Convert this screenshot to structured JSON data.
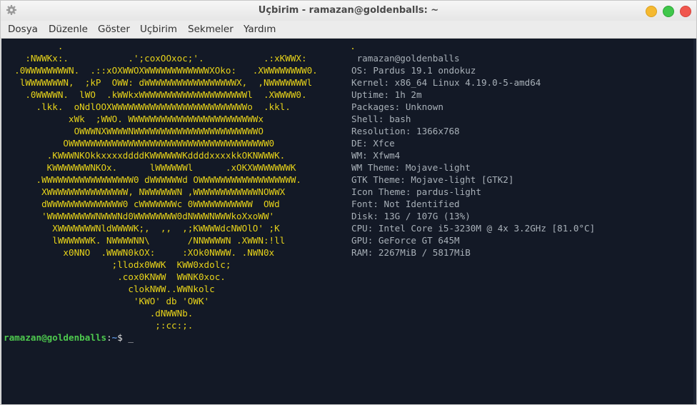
{
  "window": {
    "title": "Uçbirim - ramazan@goldenballs: ~"
  },
  "menu": [
    "Dosya",
    "Düzenle",
    "Göster",
    "Uçbirim",
    "Sekmeler",
    "Yardım"
  ],
  "ascii_logo": [
    "          .                                                     .",
    "    :NWWKx:.           .';coxOOxoc;'.           .:xKWWX:",
    "  .0WWWWWWWWN.  .::xOXWWOXWWWWWWWWWWWWXOko:   .XWWWWWWWW0.",
    "   lWWWWWWWN,  ;kP  OWW: dWWWWWWWWWWWWWWWWWX,  ,NWWWWWWWl",
    "    .0WWWWN.  lWO  .kWWkxWWWWWWWWWWWWWWWWWWWWl  .XWWWW0.",
    "      .lkk.  oNdlOOXWWWWWWWWWWWWWWWWWWWWWWWWWo  .kkl.",
    "            xWk  ;WWO. WWWWWWWWWWWWWWWWWWWWWWWWx",
    "             OWWWNXWWWWNWWWWWWWWWWWWWWWWWWWWWWWO",
    "           OWWWWWWWWWWWWWWWWWWWWWWWWWWWWWWWWWWWWW0",
    "        .KWWWNKOkkxxxxddddKWWWWWWKddddxxxxkkOKNWWWK.",
    "        KWWWWWWWNKOx.      lWWWWWWl      .xOKXWWWWWWWK",
    "      .WWWWWWWWWWWWWWWWW0 dWWWWWWd OWWWWWWWWWWWWWWWWWW.",
    "       XWWWWWWWWWWWWWWW, NWWWWWWN ,WWWWWWWWWWWWNOWWX",
    "       dWWWWWWWWWWWWWW0 cWWWWWWWc 0WWWWWWWWWWW  OWd",
    "       'WWWWWWWWWNWWWNd0WWWWWWWW0dNWWWNWWWkoXxoWW'",
    "         XWWWWWWWNldWWWWK;,  ,,  ,;KWWWWdcNWOlO' ;K",
    "         lWWWWWWK. NWWWWNN\\       /NNWWWWN .XWWN:!ll",
    "           x0NNO  .WWWN0kOX:     :XOk0NWWW. .NWN0x",
    "                    ;llodx0WWK  KWW0xdolc;",
    "                     .cox0KNWW  WWNK0xoc.",
    "                       clokNWW..WWNkolc",
    "                        'KWO' db 'OWK'",
    "                           .dNWWNb.",
    "                            ;:cc:;."
  ],
  "sysinfo": [
    " ramazan@goldenballs",
    "OS: Pardus 19.1 ondokuz",
    "Kernel: x86_64 Linux 4.19.0-5-amd64",
    "Uptime: 1h 2m",
    "Packages: Unknown",
    "Shell: bash",
    "Resolution: 1366x768",
    "DE: Xfce",
    "WM: Xfwm4",
    "WM Theme: Mojave-light",
    "GTK Theme: Mojave-light [GTK2]",
    "Icon Theme: pardus-light",
    "Font: Not Identified",
    "Disk: 13G / 107G (13%)",
    "CPU: Intel Core i5-3230M @ 4x 3.2GHz [81.0°C]",
    "GPU: GeForce GT 645M",
    "RAM: 2267MiB / 5817MiB"
  ],
  "prompt": {
    "user": "ramazan@goldenballs",
    "colon": ":",
    "path": "~",
    "symbol": "$ ",
    "cursor": "_"
  },
  "colors": {
    "terminal_bg": "#131926",
    "logo": "#e6d21a",
    "info": "#a8b0b8",
    "prompt_user": "#4ec94e",
    "prompt_path": "#5a8fd8"
  }
}
